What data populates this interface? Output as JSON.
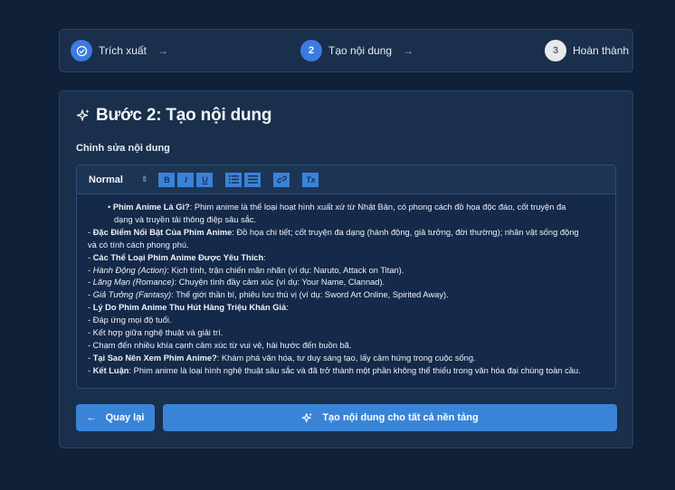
{
  "stepper": {
    "steps": [
      {
        "number": "✓",
        "label": "Trích xuất",
        "state": "done"
      },
      {
        "number": "2",
        "label": "Tạo nội dung",
        "state": "active"
      },
      {
        "number": "3",
        "label": "Hoàn thành",
        "state": "pending"
      }
    ],
    "arrow": "→"
  },
  "card": {
    "title": "Bước 2: Tạo nội dung",
    "section_label": "Chỉnh sửa nội dung"
  },
  "toolbar": {
    "format_select": "Normal",
    "bold": "B",
    "italic": "I",
    "underline": "U",
    "ordered_list": "≡",
    "bullet_list": "☰",
    "link": "⛓",
    "clear": "Tx"
  },
  "content": {
    "l1_b": "Phim Anime Là Gì?",
    "l1_t": ": Phim anime là thể loại hoạt hình xuất xứ từ Nhật Bản, có phong cách đồ họa độc đáo, cốt truyện đa",
    "l1_t2": "dạng và truyền tải thông điệp sâu sắc.",
    "l2_p": "- ",
    "l2_b": "Đặc Điểm Nổi Bật Của Phim Anime",
    "l2_t": ": Đồ họa chi tiết; cốt truyện đa dạng (hành động, giả tưởng, đời thường); nhân vật sống động",
    "l2_t2": "và có tính cách phong phú.",
    "l3_p": "- ",
    "l3_b": "Các Thể Loại Phim Anime Được Yêu Thích",
    "l3_t": ":",
    "l4_p": "- ",
    "l4_i": "Hành Động (Action)",
    "l4_t": ": Kịch tính, trận chiến mãn nhãn (ví dụ: Naruto, Attack on Titan).",
    "l5_p": "- ",
    "l5_i": "Lãng Mạn (Romance)",
    "l5_t": ": Chuyện tình đầy cảm xúc (ví dụ: Your Name, Clannad).",
    "l6_p": "- ",
    "l6_i": "Giả Tưởng (Fantasy)",
    "l6_t": ": Thế giới thần bí, phiêu lưu thú vị (ví dụ: Sword Art Online, Spirited Away).",
    "l7_p": "- ",
    "l7_b": "Lý Do Phim Anime Thu Hút Hàng Triệu Khán Giả",
    "l7_t": ":",
    "l8": "- Đáp ứng mọi độ tuổi.",
    "l9": "- Kết hợp giữa nghệ thuật và giải trí.",
    "l10": "- Chạm đến nhiều khía cạnh cảm xúc từ vui vẻ, hài hước đến buồn bã.",
    "l11_p": "- ",
    "l11_b": "Tại Sao Nên Xem Phim Anime?",
    "l11_t": ": Khám phá văn hóa, tư duy sáng tạo, lấy cảm hứng trong cuộc sống.",
    "l12_p": "- ",
    "l12_b": "Kết Luận",
    "l12_t": ": Phim anime là loại hình nghệ thuật sâu sắc và đã trở thành một phần không thể thiếu trong văn hóa đại chúng toàn cầu."
  },
  "buttons": {
    "back": "Quay lại",
    "back_icon": "←",
    "generate": "Tạo nội dung cho tất cả nền tảng"
  },
  "colors": {
    "background": "#0f2038",
    "card": "#1a2f4b",
    "accent": "#3a84d8"
  }
}
